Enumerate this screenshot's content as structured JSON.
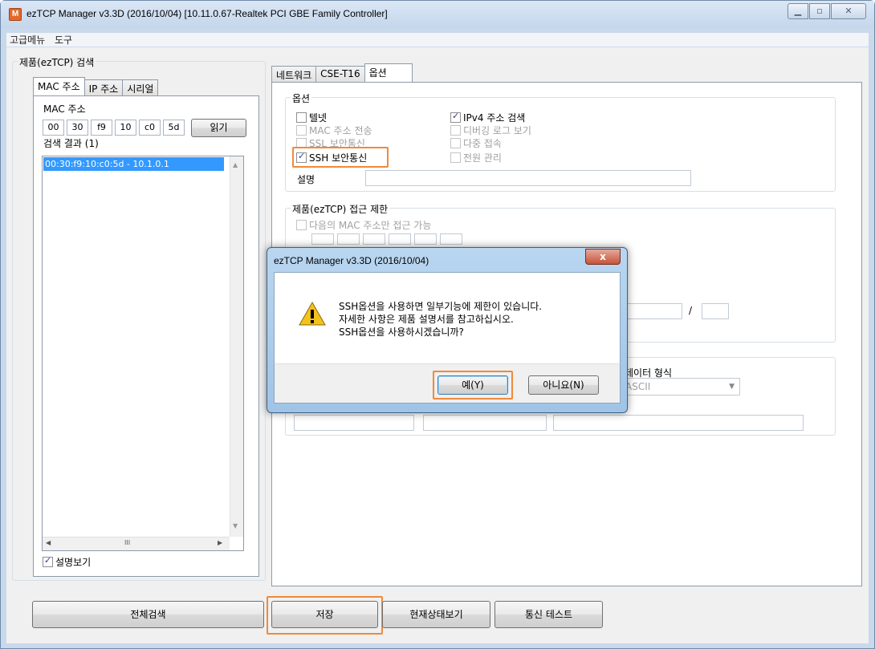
{
  "window": {
    "title": "ezTCP Manager v3.3D (2016/10/04) [10.11.0.67-Realtek PCI GBE Family Controller]",
    "app_icon": "M"
  },
  "menu": [
    "고급메뉴",
    "도구"
  ],
  "search_group": {
    "legend": "제품(ezTCP) 검색",
    "tabs": [
      "MAC 주소",
      "IP 주소",
      "시리얼"
    ],
    "mac_label": "MAC 주소",
    "mac_octets": [
      "00",
      "30",
      "f9",
      "10",
      "c0",
      "5d"
    ],
    "read_button": "읽기",
    "results_label": "검색 결과 (1)",
    "results": [
      "00:30:f9:10:c0:5d - 10.1.0.1"
    ],
    "show_desc_label": "설명보기",
    "show_desc_checked": true
  },
  "settings_tabs": [
    "네트워크",
    "CSE-T16",
    "옵션"
  ],
  "options_group": {
    "legend": "옵션",
    "checkboxes_left": [
      {
        "label": "텔넷",
        "checked": false,
        "disabled": false
      },
      {
        "label": "MAC 주소 전송",
        "checked": false,
        "disabled": true
      },
      {
        "label": "SSL 보안통신",
        "checked": false,
        "disabled": true
      },
      {
        "label": "SSH 보안통신",
        "checked": true,
        "disabled": false
      }
    ],
    "checkboxes_right": [
      {
        "label": "IPv4 주소 검색",
        "checked": true,
        "disabled": false
      },
      {
        "label": "디버깅 로그 보기",
        "checked": false,
        "disabled": true
      },
      {
        "label": "다중 접속",
        "checked": false,
        "disabled": true
      },
      {
        "label": "전원 관리",
        "checked": false,
        "disabled": true
      }
    ],
    "description_label": "설명"
  },
  "access_group": {
    "legend": "제품(ezTCP) 접근 제한",
    "mac_only_label": "다음의 MAC 주소만 접근 가능",
    "slash": "/"
  },
  "data_group": {
    "format_label": "데이터 형식",
    "format_value": "ASCII"
  },
  "bottom_buttons": {
    "search_all": "전체검색",
    "save": "저장",
    "status": "현재상태보기",
    "comm_test": "통신 테스트"
  },
  "dialog": {
    "title": "ezTCP Manager v3.3D (2016/10/04)",
    "close": "x",
    "lines": [
      "SSH옵션을 사용하면 일부기능에 제한이 있습니다.",
      "자세한 사항은 제품 설명서를 참고하십시오.",
      "SSH옵션을 사용하시겠습니까?"
    ],
    "yes": "예(Y)",
    "no": "아니요(N)"
  },
  "colors": {
    "highlight": "#ef8a3a",
    "selection": "#3399ff"
  }
}
